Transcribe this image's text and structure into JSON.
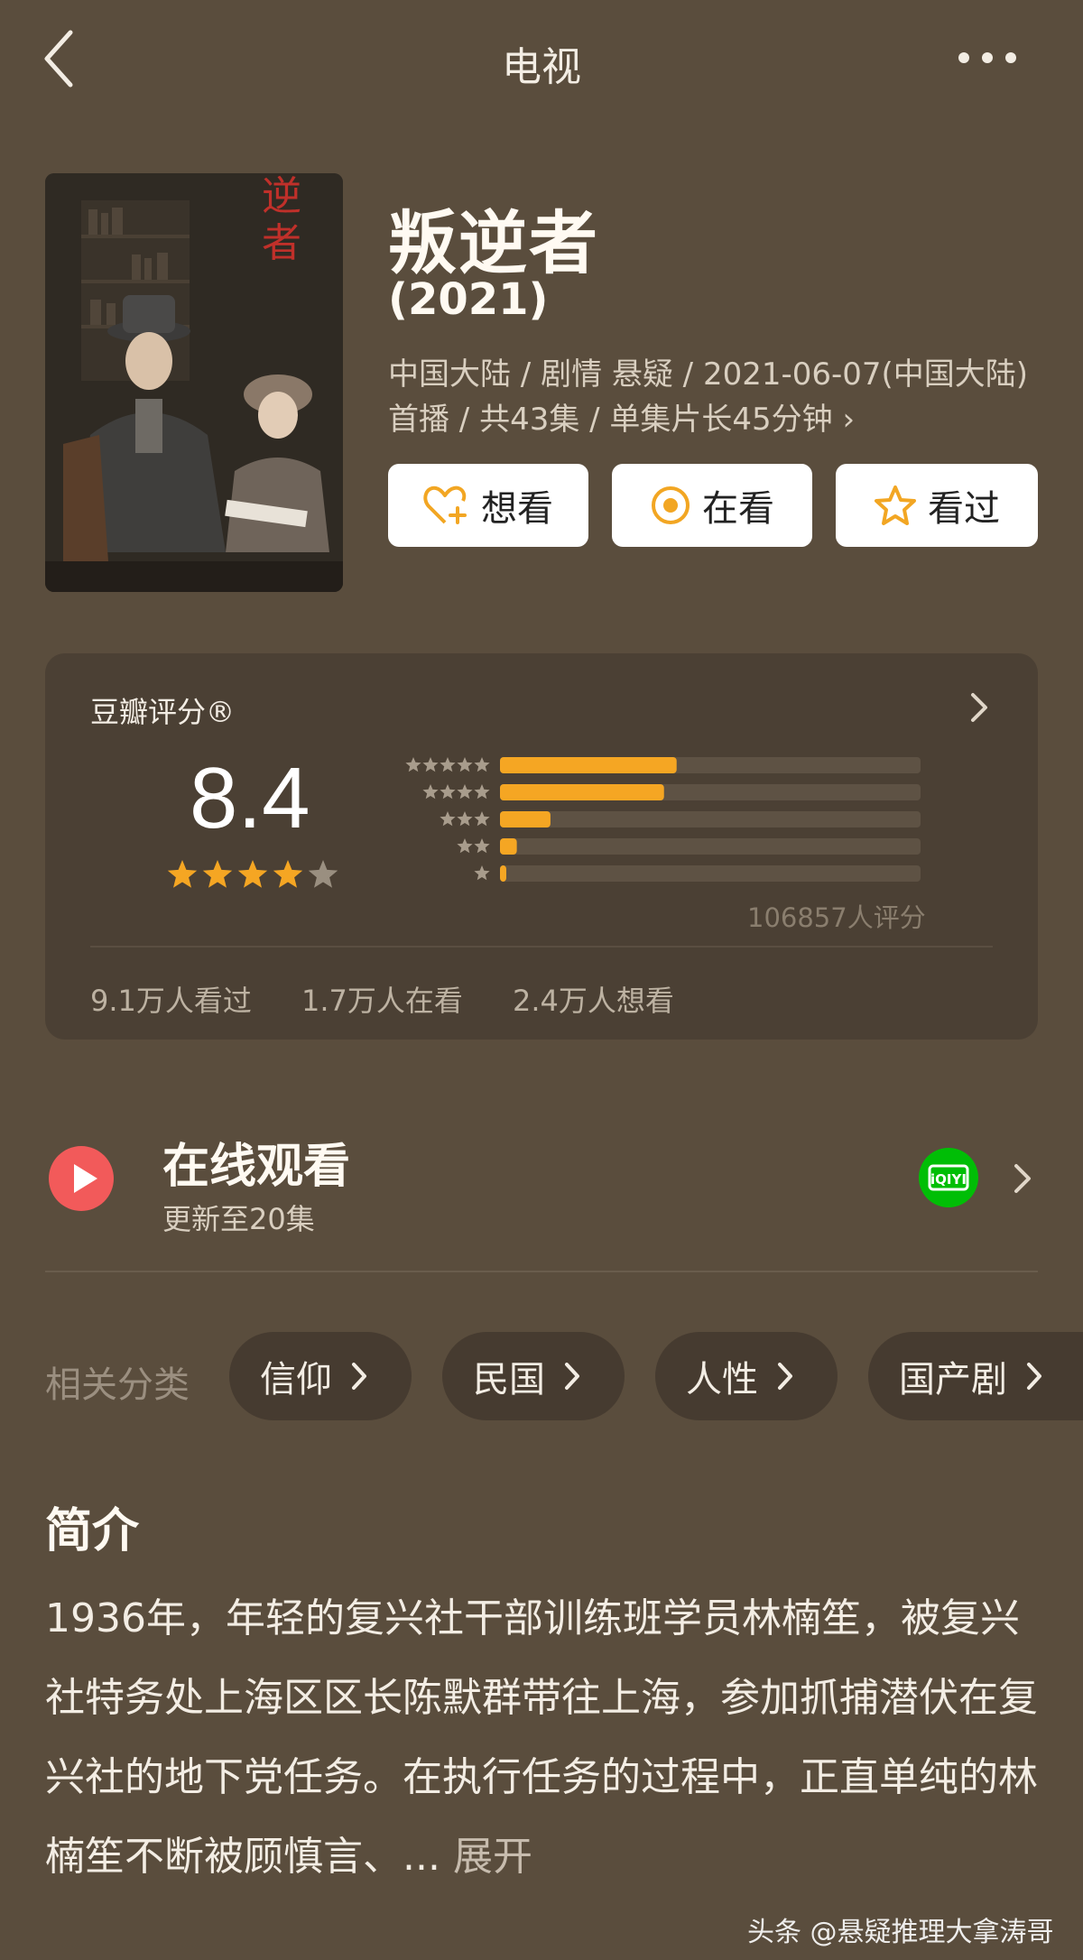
{
  "nav": {
    "title": "电视"
  },
  "show": {
    "title": "叛逆者",
    "year": "(2021)",
    "meta": "中国大陆 / 剧情 悬疑 / 2021-06-07(中国大陆)首播 / 共43集 / 单集片长45分钟 ›",
    "poster_text": "逆者"
  },
  "actions": [
    {
      "label": "想看",
      "icon": "heart-plus-icon"
    },
    {
      "label": "在看",
      "icon": "target-icon"
    },
    {
      "label": "看过",
      "icon": "star-outline-icon"
    }
  ],
  "rating": {
    "label": "豆瓣评分®",
    "score": "8.4",
    "stars": 4,
    "count": "106857人评分",
    "distribution": [
      {
        "stars": 5,
        "fraction": 0.42
      },
      {
        "stars": 4,
        "fraction": 0.39
      },
      {
        "stars": 3,
        "fraction": 0.12
      },
      {
        "stars": 2,
        "fraction": 0.04
      },
      {
        "stars": 1,
        "fraction": 0.015
      }
    ],
    "bar_color": "#f5a623",
    "watched": "9.1万人看过",
    "watching": "1.7万人在看",
    "want": "2.4万人想看"
  },
  "online": {
    "title": "在线观看",
    "subtitle": "更新至20集",
    "play_color": "#f25a5a",
    "provider_icon": "iqiyi-icon",
    "provider_color": "#00be06"
  },
  "tags": {
    "label": "相关分类",
    "items": [
      "信仰",
      "民国",
      "人性",
      "国产剧"
    ]
  },
  "synopsis": {
    "title": "简介",
    "text": "1936年，年轻的复兴社干部训练班学员林楠笙，被复兴社特务处上海区区长陈默群带往上海，参加抓捕潜伏在复兴社的地下党任务。在执行任务的过程中，正直单纯的林楠笙不断被顾慎言、...",
    "expand": "展开"
  },
  "watermark": "头条 @悬疑推理大拿涛哥"
}
